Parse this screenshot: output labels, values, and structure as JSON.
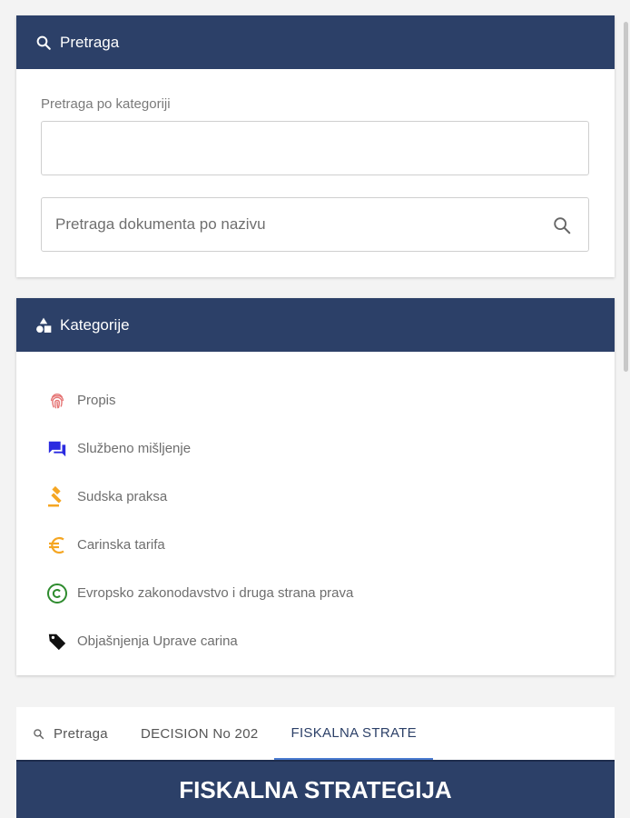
{
  "search_panel": {
    "title": "Pretraga",
    "category_label": "Pretraga po kategoriji",
    "category_value": "",
    "doc_placeholder": "Pretraga dokumenta po nazivu"
  },
  "categories_panel": {
    "title": "Kategorije",
    "items": [
      {
        "label": "Propis",
        "icon": "fingerprint-icon",
        "color": "#e57373"
      },
      {
        "label": "Službeno mišljenje",
        "icon": "chat-bubbles-icon",
        "color": "#2a2ae0"
      },
      {
        "label": "Sudska praksa",
        "icon": "gavel-icon",
        "color": "#f5a623"
      },
      {
        "label": "Carinska tarifa",
        "icon": "euro-icon",
        "color": "#f5a623"
      },
      {
        "label": "Evropsko zakonodavstvo i druga strana prava",
        "icon": "copyright-icon",
        "color": "#2e8b2e"
      },
      {
        "label": "Objašnjenja Uprave carina",
        "icon": "tag-icon",
        "color": "#111111"
      }
    ]
  },
  "tabs": [
    {
      "label": "Pretraga",
      "active": false
    },
    {
      "label": "DECISION No 202",
      "active": false
    },
    {
      "label": "FISKALNA STRATE",
      "active": true
    }
  ],
  "document": {
    "title": "FISKALNA STRATEGIJA"
  },
  "colors": {
    "header_bg": "#2c4068",
    "active_tab_underline": "#4a7bd0"
  }
}
